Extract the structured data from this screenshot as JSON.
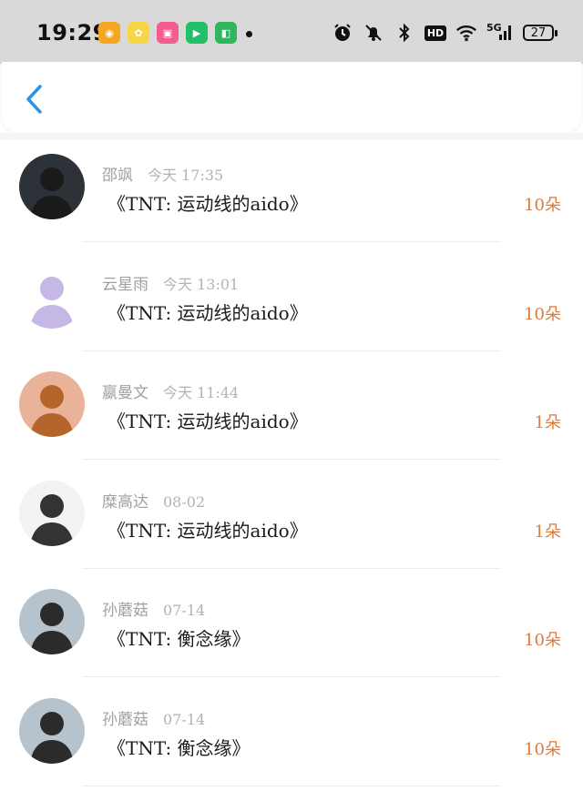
{
  "status_bar": {
    "time": "19:29",
    "apps": [
      {
        "name": "weibo-icon",
        "color": "#f5a623",
        "glyph": "◉"
      },
      {
        "name": "sunflower-app-icon",
        "color": "#f6d743",
        "glyph": "✿"
      },
      {
        "name": "bilibili-icon",
        "color": "#f25d8e",
        "glyph": "▣"
      },
      {
        "name": "video-app-icon",
        "color": "#23c06a",
        "glyph": "▶"
      },
      {
        "name": "shopping-app-icon",
        "color": "#2fb55c",
        "glyph": "◧"
      }
    ],
    "network": "5G",
    "hd_label": "HD",
    "battery": "27"
  },
  "items": [
    {
      "name": "邵飒",
      "date": "今天 17:35",
      "title": "《TNT: 运动线的aido》",
      "count": "10朵",
      "avatar_bg": "#2d3238",
      "avatar_fg": "#1a1a1a"
    },
    {
      "name": "云星雨",
      "date": "今天 13:01",
      "title": "《TNT: 运动线的aido》",
      "count": "10朵",
      "avatar_bg": "#ffffff",
      "avatar_fg": "#c6b8e6"
    },
    {
      "name": "嬴曼文",
      "date": "今天 11:44",
      "title": "《TNT: 运动线的aido》",
      "count": "1朵",
      "avatar_bg": "#e9b39a",
      "avatar_fg": "#b5652b"
    },
    {
      "name": "糜高达",
      "date": "08-02",
      "title": "《TNT: 运动线的aido》",
      "count": "1朵",
      "avatar_bg": "#f3f3f3",
      "avatar_fg": "#333333"
    },
    {
      "name": "孙蘑菇",
      "date": "07-14",
      "title": "《TNT: 衡念缘》",
      "count": "10朵",
      "avatar_bg": "#b7c3cc",
      "avatar_fg": "#2b2b2b"
    },
    {
      "name": "孙蘑菇",
      "date": "07-14",
      "title": "《TNT: 衡念缘》",
      "count": "10朵",
      "avatar_bg": "#b7c3cc",
      "avatar_fg": "#2b2b2b"
    }
  ]
}
